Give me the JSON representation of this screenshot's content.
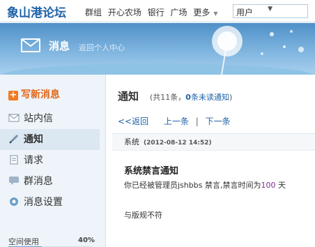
{
  "site": {
    "logo": "象山港论坛"
  },
  "nav": {
    "items": [
      "群组",
      "开心农场",
      "银行",
      "广场"
    ],
    "more": "更多"
  },
  "user_menu": {
    "label": "用户"
  },
  "banner": {
    "title": "消息",
    "subtitle": "返回个人中心"
  },
  "sidebar": {
    "compose": "写新消息",
    "items": [
      {
        "label": "站内信"
      },
      {
        "label": "通知"
      },
      {
        "label": "请求"
      },
      {
        "label": "群消息"
      },
      {
        "label": "消息设置"
      }
    ],
    "space_label": "空间使用",
    "space_percent": "40%",
    "space_fraction": 0.4
  },
  "main": {
    "title": "通知",
    "count_prefix": "(共11条，",
    "unread_count": "0",
    "unread_link": "条未读通知",
    "count_suffix": ")",
    "pager": {
      "back": "<<返回",
      "prev": "上一条",
      "next": "下一条"
    },
    "message": {
      "sender": "系统",
      "time": "(2012-08-12 14:52)",
      "title": "系统禁言通知",
      "body_prefix": "你已经被管理员jshbbs 禁言,禁言时间为",
      "days": "100",
      "body_suffix": " 天",
      "reason": "与版规不符"
    }
  },
  "colors": {
    "accent": "#1e62a8",
    "compose": "#e2671a",
    "banner": "#4f90c8"
  }
}
